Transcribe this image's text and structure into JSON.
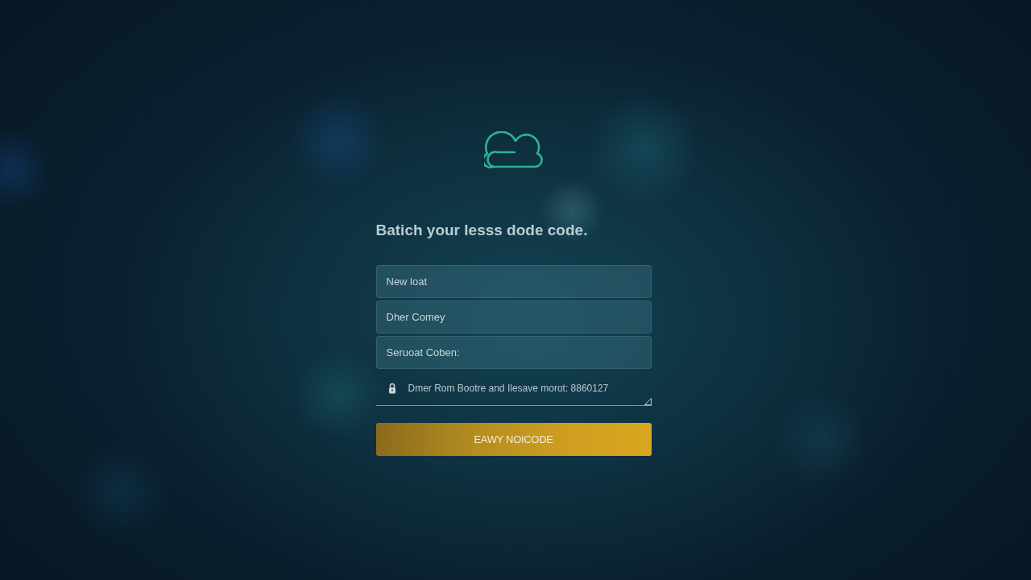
{
  "heading": "Batich your lesss dode code.",
  "fields": [
    {
      "kind": "box",
      "placeholder": "New loat"
    },
    {
      "kind": "box",
      "placeholder": "Dher Comey"
    },
    {
      "kind": "box",
      "placeholder": "Seruoat Coben:"
    },
    {
      "kind": "note",
      "placeholder": "Dmer Rom Bootre and Ilesave morot: 8860127"
    }
  ],
  "button": "EAWY NOICODE"
}
